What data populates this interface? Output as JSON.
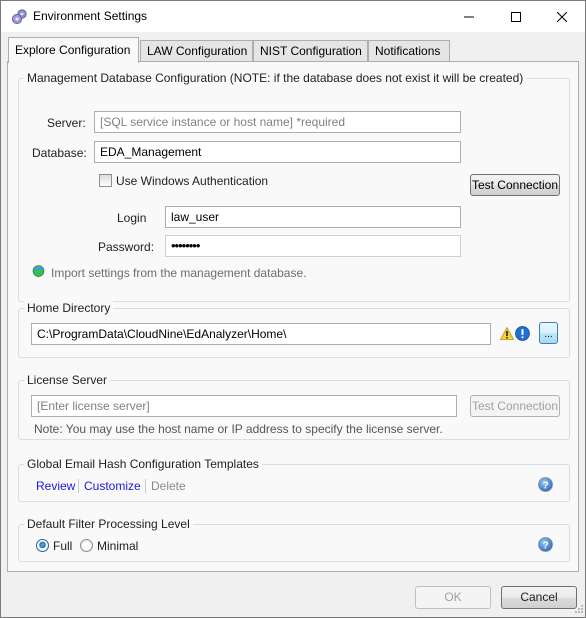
{
  "window": {
    "title": "Environment Settings",
    "icon": "gears-icon",
    "controls": {
      "minimize": "minimize-icon",
      "maximize": "maximize-icon",
      "close": "close-icon"
    }
  },
  "tabs": [
    {
      "label": "Explore Configuration",
      "active": true
    },
    {
      "label": "LAW Configuration",
      "active": false
    },
    {
      "label": "NIST Configuration",
      "active": false
    },
    {
      "label": "Notifications",
      "active": false
    }
  ],
  "management_db": {
    "group_title": "Management Database Configuration (NOTE: if the database does not exist it will be created)",
    "server_label": "Server:",
    "server_value": "",
    "server_placeholder": "[SQL service instance or host name] *required",
    "database_label": "Database:",
    "database_value": "EDA_Management",
    "windows_auth_label": "Use Windows Authentication",
    "windows_auth_checked": false,
    "test_connection_label": "Test Connection",
    "login_label": "Login",
    "login_value": "law_user",
    "password_label": "Password:",
    "password_value": "••••••••",
    "import_label": "Import settings from the management database.",
    "import_icon": "database-import-icon"
  },
  "home_directory": {
    "group_title": "Home Directory",
    "path_value": "C:\\ProgramData\\CloudNine\\EdAnalyzer\\Home\\",
    "warning_icon": "warning-icon",
    "info_icon": "info-icon",
    "browse_label": "..."
  },
  "license_server": {
    "group_title": "License Server",
    "value": "",
    "placeholder": "[Enter license server]",
    "test_connection_label": "Test Connection",
    "test_connection_enabled": false,
    "note": "Note: You may use the host name or IP address to specify the license server."
  },
  "email_hash": {
    "group_title": "Global Email Hash Configuration Templates",
    "links": [
      {
        "label": "Review",
        "enabled": true
      },
      {
        "label": "Customize",
        "enabled": true
      },
      {
        "label": "Delete",
        "enabled": false
      }
    ],
    "help_icon": "help-icon"
  },
  "filter_level": {
    "group_title": "Default Filter Processing Level",
    "options": [
      {
        "label": "Full",
        "selected": true
      },
      {
        "label": "Minimal",
        "selected": false
      }
    ],
    "help_icon": "help-icon"
  },
  "footer": {
    "ok_label": "OK",
    "ok_enabled": false,
    "cancel_label": "Cancel"
  },
  "colors": {
    "link": "#1a1adb",
    "panel_bg": "#f9f9f9",
    "window_bg": "#f0f0f0"
  }
}
